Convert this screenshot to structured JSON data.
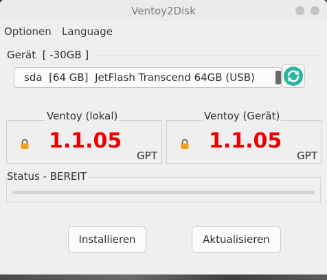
{
  "window": {
    "title": "Ventoy2Disk"
  },
  "menu": {
    "items": [
      "Optionen",
      "Language"
    ]
  },
  "device": {
    "group_label": "Gerät  [ -30GB ]",
    "selected": "sda  [64 GB]  JetFlash Transcend 64GB (USB)",
    "refresh_icon": "refresh-icon"
  },
  "local": {
    "label": "Ventoy (lokal)",
    "version": "1.1.05",
    "style": "GPT",
    "icon": "lock-icon"
  },
  "device_version": {
    "label": "Ventoy (Gerät)",
    "version": "1.1.05",
    "style": "GPT",
    "icon": "lock-icon"
  },
  "status": {
    "label": "Status - BEREIT",
    "progress": 0
  },
  "buttons": {
    "install": "Installieren",
    "update": "Aktualisieren"
  },
  "colors": {
    "version": "#ee0000",
    "lock": "#f0a020",
    "refresh": "#2bb5a0"
  }
}
